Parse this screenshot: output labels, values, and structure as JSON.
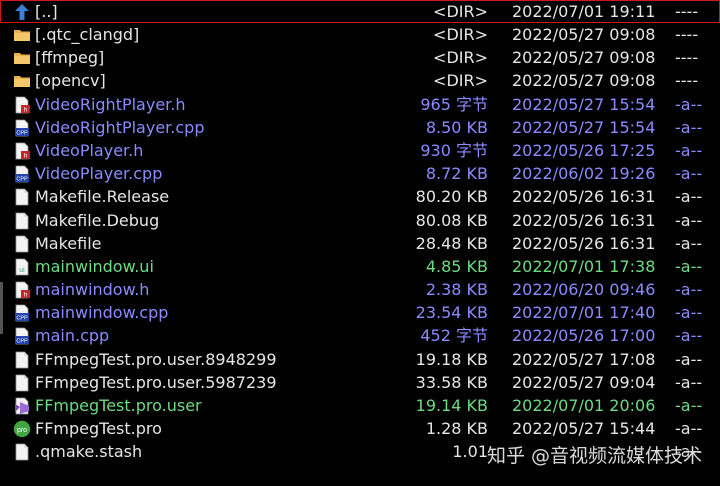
{
  "files": [
    {
      "name": "[..]",
      "size": "<DIR>",
      "date": "2022/07/01 19:11",
      "attr": "----",
      "icon": "up-arrow-icon",
      "color": "white",
      "selected": true
    },
    {
      "name": "[.qtc_clangd]",
      "size": "<DIR>",
      "date": "2022/05/27 09:08",
      "attr": "----",
      "icon": "folder-icon",
      "color": "white"
    },
    {
      "name": "[ffmpeg]",
      "size": "<DIR>",
      "date": "2022/05/27 09:08",
      "attr": "----",
      "icon": "folder-icon",
      "color": "white"
    },
    {
      "name": "[opencv]",
      "size": "<DIR>",
      "date": "2022/05/27 09:08",
      "attr": "----",
      "icon": "folder-icon",
      "color": "white"
    },
    {
      "name": "VideoRightPlayer.h",
      "size": "965 字节",
      "date": "2022/05/27 15:54",
      "attr": "-a--",
      "icon": "header-file-icon",
      "color": "blue"
    },
    {
      "name": "VideoRightPlayer.cpp",
      "size": "8.50 KB",
      "date": "2022/05/27 15:54",
      "attr": "-a--",
      "icon": "cpp-file-icon",
      "color": "blue"
    },
    {
      "name": "VideoPlayer.h",
      "size": "930 字节",
      "date": "2022/05/26 17:25",
      "attr": "-a--",
      "icon": "header-file-icon",
      "color": "blue"
    },
    {
      "name": "VideoPlayer.cpp",
      "size": "8.72 KB",
      "date": "2022/06/02 19:26",
      "attr": "-a--",
      "icon": "cpp-file-icon",
      "color": "blue"
    },
    {
      "name": "Makefile.Release",
      "size": "80.20 KB",
      "date": "2022/05/26 16:31",
      "attr": "-a--",
      "icon": "document-icon",
      "color": "white"
    },
    {
      "name": "Makefile.Debug",
      "size": "80.08 KB",
      "date": "2022/05/26 16:31",
      "attr": "-a--",
      "icon": "document-icon",
      "color": "white"
    },
    {
      "name": "Makefile",
      "size": "28.48 KB",
      "date": "2022/05/26 16:31",
      "attr": "-a--",
      "icon": "document-icon",
      "color": "white"
    },
    {
      "name": "mainwindow.ui",
      "size": "4.85 KB",
      "date": "2022/07/01 17:38",
      "attr": "-a--",
      "icon": "ui-file-icon",
      "color": "green"
    },
    {
      "name": "mainwindow.h",
      "size": "2.38 KB",
      "date": "2022/06/20 09:46",
      "attr": "-a--",
      "icon": "header-file-icon",
      "color": "blue"
    },
    {
      "name": "mainwindow.cpp",
      "size": "23.54 KB",
      "date": "2022/07/01 17:40",
      "attr": "-a--",
      "icon": "cpp-file-icon",
      "color": "blue"
    },
    {
      "name": "main.cpp",
      "size": "452 字节",
      "date": "2022/05/26 17:00",
      "attr": "-a--",
      "icon": "cpp-file-icon",
      "color": "blue"
    },
    {
      "name": "FFmpegTest.pro.user.8948299",
      "size": "19.18 KB",
      "date": "2022/05/27 17:08",
      "attr": "-a--",
      "icon": "document-icon",
      "color": "white"
    },
    {
      "name": "FFmpegTest.pro.user.5987239",
      "size": "33.58 KB",
      "date": "2022/05/27 09:04",
      "attr": "-a--",
      "icon": "document-icon",
      "color": "white"
    },
    {
      "name": "FFmpegTest.pro.user",
      "size": "19.14 KB",
      "date": "2022/07/01 20:06",
      "attr": "-a--",
      "icon": "vs-file-icon",
      "color": "green"
    },
    {
      "name": "FFmpegTest.pro",
      "size": "1.28 KB",
      "date": "2022/05/27 15:44",
      "attr": "-a--",
      "icon": "pro-file-icon",
      "color": "white"
    },
    {
      "name": ".qmake.stash",
      "size": "1.01",
      "date": "",
      "attr": "-a--",
      "icon": "document-icon",
      "color": "white"
    }
  ],
  "watermark": "知乎 @音视频流媒体技术",
  "colors": {
    "white": "#e6e6e6",
    "blue": "#8b8bff",
    "green": "#6ddc82",
    "selection": "#d01818"
  }
}
